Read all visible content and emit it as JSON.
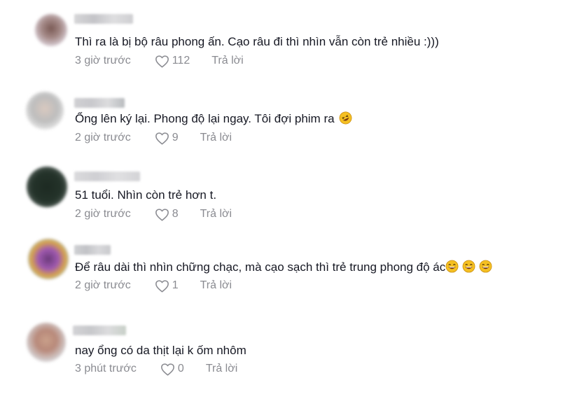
{
  "comments": [
    {
      "text": "Thì ra là bị bộ râu phong ấn. Cạo râu đi thì nhìn vẫn còn trẻ nhiều :)))",
      "time": "3 giờ trước",
      "likes": "112",
      "reply_label": "Trả lời"
    },
    {
      "text": "Ổng lên ký lại. Phong độ lại ngay. Tôi đợi phim ra",
      "time": "2 giờ trước",
      "likes": "9",
      "reply_label": "Trả lời",
      "emojis": [
        "rofl-emoji"
      ]
    },
    {
      "text": "51 tuổi. Nhìn còn trẻ hơn t.",
      "time": "2 giờ trước",
      "likes": "8",
      "reply_label": "Trả lời"
    },
    {
      "text": "Để râu dài thì nhìn chững chạc, mà cạo sạch thì trẻ trung phong độ ác",
      "time": "2 giờ trước",
      "likes": "1",
      "reply_label": "Trả lời",
      "emojis": [
        "laughing-emoji",
        "laughing-emoji",
        "laughing-emoji"
      ]
    },
    {
      "text": "nay ổng có da thịt lại k ốm nhôm",
      "time": "3 phút trước",
      "likes": "0",
      "reply_label": "Trả lời"
    }
  ],
  "colors": {
    "text": "#161823",
    "meta": "#8a8b91",
    "emoji_face": "#f5c022"
  }
}
